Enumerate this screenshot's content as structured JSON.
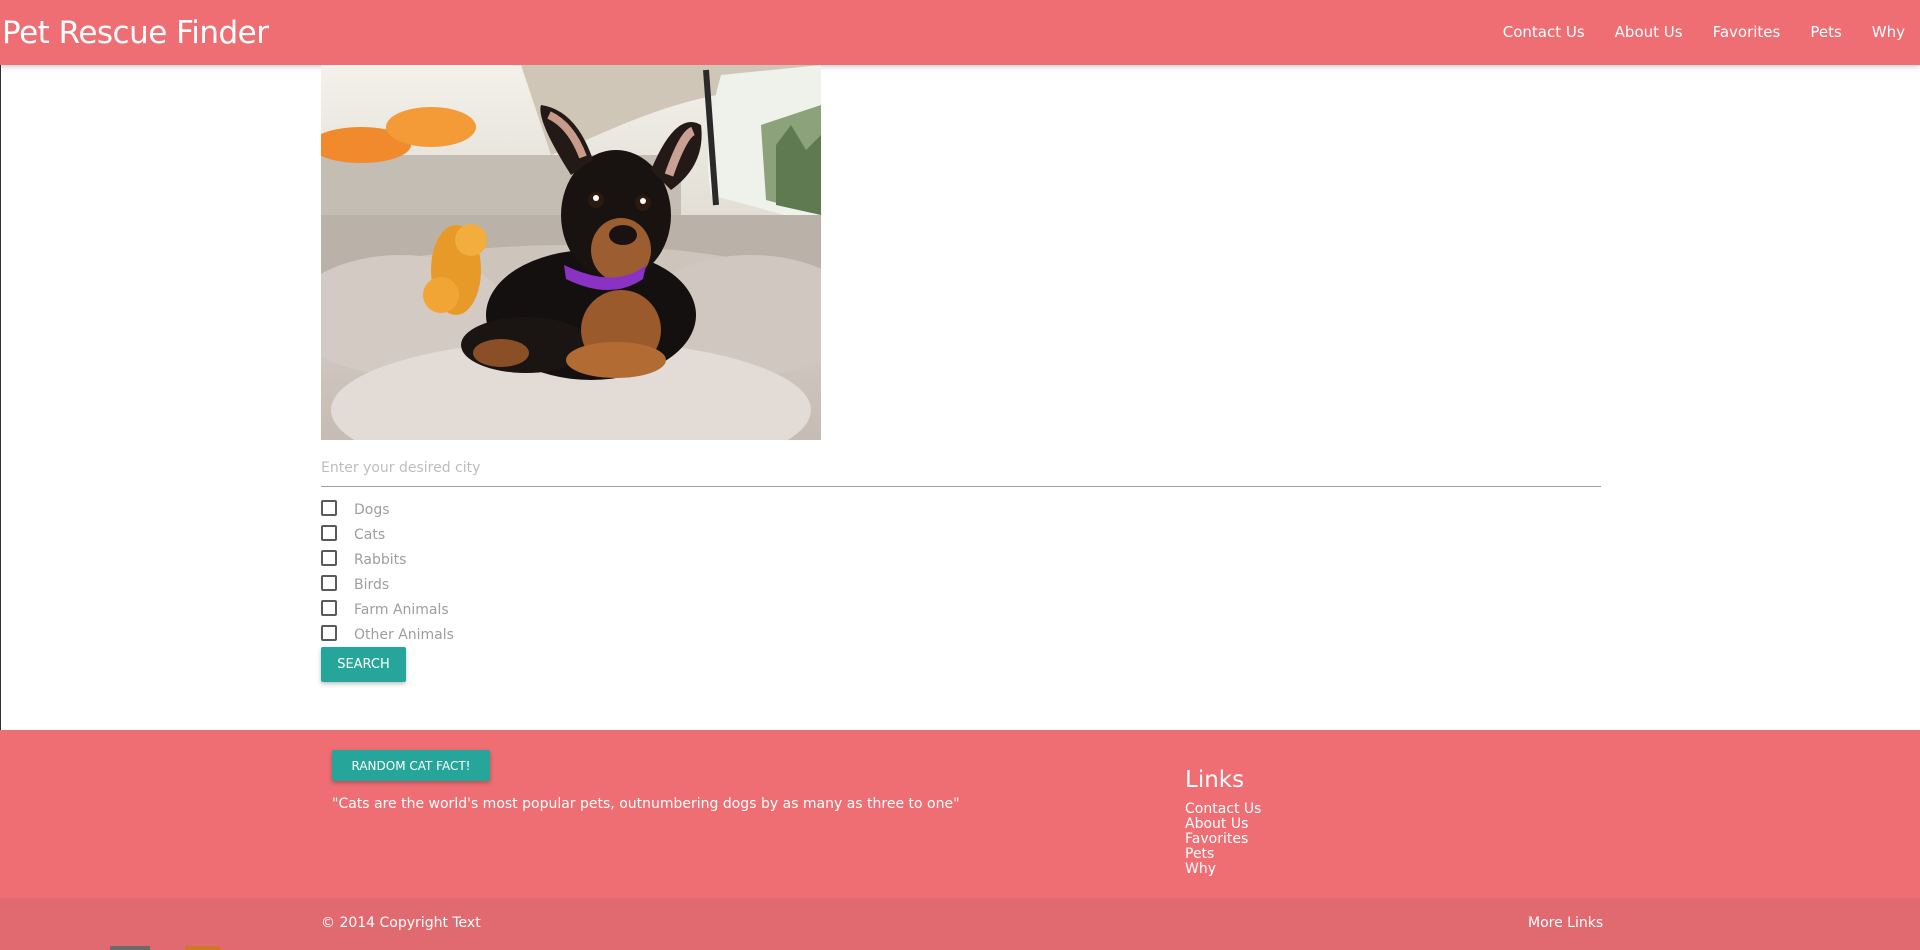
{
  "navbar": {
    "brand": "Pet Rescue Finder",
    "links": [
      "Contact Us",
      "About Us",
      "Favorites",
      "Pets",
      "Why"
    ]
  },
  "search": {
    "placeholder": "Enter your desired city",
    "value": "",
    "categories": [
      "Dogs",
      "Cats",
      "Rabbits",
      "Birds",
      "Farm Animals",
      "Other Animals"
    ],
    "button_label": "Search"
  },
  "footer": {
    "cat_fact_button": "Random Cat Fact!",
    "cat_fact": "\"Cats are the world's most popular pets, outnumbering dogs by as many as three to one\"",
    "links_title": "Links",
    "links": [
      "Contact Us",
      "About Us",
      "Favorites",
      "Pets",
      "Why"
    ],
    "copyright": "© 2014 Copyright Text",
    "more_links": "More Links"
  },
  "colors": {
    "primary": "#ee6e73",
    "accent": "#26a69a"
  }
}
